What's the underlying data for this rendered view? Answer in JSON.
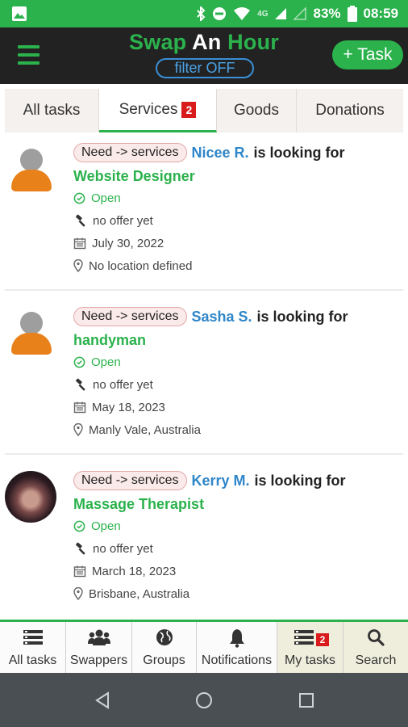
{
  "status_bar": {
    "network": "4G",
    "battery": "83%",
    "time": "08:59"
  },
  "header": {
    "title_part1": "Swap",
    "title_part2": "An",
    "title_part3": "Hour",
    "filter_label": "filter OFF",
    "add_task_label": "+ Task"
  },
  "tabs": [
    {
      "label": "All tasks",
      "badge": ""
    },
    {
      "label": "Services",
      "badge": "2"
    },
    {
      "label": "Goods",
      "badge": ""
    },
    {
      "label": "Donations",
      "badge": ""
    }
  ],
  "tasks": [
    {
      "category": "Need -> services",
      "user": "Nicee R.",
      "looking": "is looking for",
      "title": "Website Designer",
      "status": "Open",
      "offer": "no offer yet",
      "date": "July 30, 2022",
      "location": "No location defined"
    },
    {
      "category": "Need -> services",
      "user": "Sasha S.",
      "looking": "is looking for",
      "title": "handyman",
      "status": "Open",
      "offer": "no offer yet",
      "date": "May 18, 2023",
      "location": "Manly Vale, Australia"
    },
    {
      "category": "Need -> services",
      "user": "Kerry M.",
      "looking": "is looking for",
      "title": "Massage Therapist",
      "status": "Open",
      "offer": "no offer yet",
      "date": "March 18, 2023",
      "location": "Brisbane, Australia"
    }
  ],
  "bottom_nav": [
    {
      "label": "All tasks",
      "icon": "list-icon",
      "badge": ""
    },
    {
      "label": "Swappers",
      "icon": "users-icon",
      "badge": ""
    },
    {
      "label": "Groups",
      "icon": "globe-icon",
      "badge": ""
    },
    {
      "label": "Notifications",
      "icon": "bell-icon",
      "badge": ""
    },
    {
      "label": "My tasks",
      "icon": "list-icon",
      "badge": "2"
    },
    {
      "label": "Search",
      "icon": "search-icon",
      "badge": ""
    }
  ],
  "colors": {
    "brand_green": "#2bb24c",
    "link_blue": "#2f86c9",
    "badge_red": "#d91b1b",
    "header_dark": "#222222"
  }
}
